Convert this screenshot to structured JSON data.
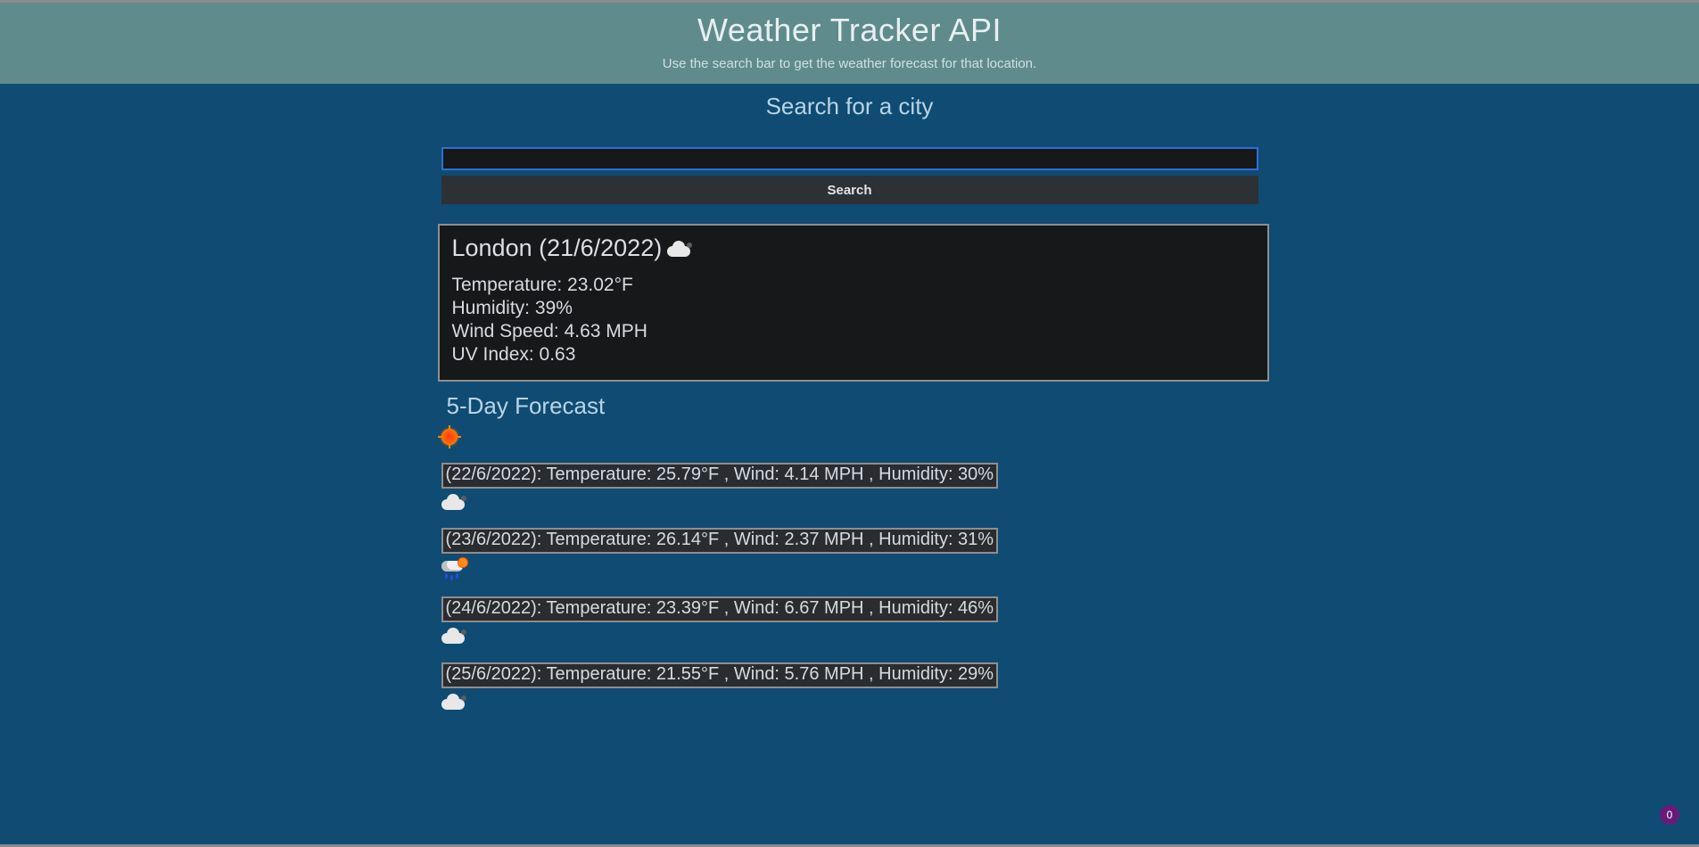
{
  "header": {
    "title": "Weather Tracker API",
    "subtitle": "Use the search bar to get the weather forecast for that location."
  },
  "search": {
    "heading": "Search for a city",
    "value": "",
    "button_label": "Search"
  },
  "current": {
    "heading": "London (21/6/2022)",
    "icon": "cloud-dark",
    "temperature": "Temperature: 23.02°F",
    "humidity": "Humidity: 39%",
    "wind": "Wind Speed: 4.63 MPH",
    "uv": "UV Index: 0.63"
  },
  "forecast": {
    "heading": "5-Day Forecast",
    "days": [
      {
        "icon": "sun",
        "line": "(22/6/2022): Temperature: 25.79°F , Wind: 4.14 MPH , Humidity: 30%"
      },
      {
        "icon": "cloud-dark",
        "line": "(23/6/2022): Temperature: 26.14°F , Wind: 2.37 MPH , Humidity: 31%"
      },
      {
        "icon": "cloud-rain",
        "line": "(24/6/2022): Temperature: 23.39°F , Wind: 6.67 MPH , Humidity: 46%"
      },
      {
        "icon": "cloud-dark",
        "line": "(25/6/2022): Temperature: 21.55°F , Wind: 5.76 MPH , Humidity: 29%"
      },
      {
        "icon": "cloud-dark",
        "line": ""
      }
    ]
  },
  "badge": "0"
}
